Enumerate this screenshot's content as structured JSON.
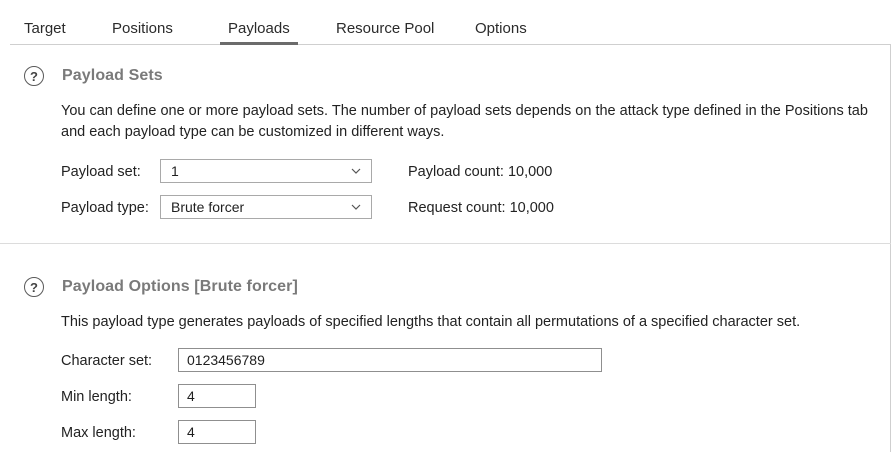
{
  "tabs": [
    {
      "label": "Target"
    },
    {
      "label": "Positions"
    },
    {
      "label": "Payloads"
    },
    {
      "label": "Resource Pool"
    },
    {
      "label": "Options"
    }
  ],
  "active_tab": "Payloads",
  "payload_sets": {
    "title": "Payload Sets",
    "description_line1": "You can define one or more payload sets. The number of payload sets depends on the attack type defined in the Positions tab",
    "description_line2": "and each payload type can be customized in different ways.",
    "payload_set_label": "Payload set:",
    "payload_set_value": "1",
    "payload_type_label": "Payload type:",
    "payload_type_value": "Brute forcer",
    "payload_count": "Payload count: 10,000",
    "request_count": "Request count: 10,000"
  },
  "payload_options": {
    "title": "Payload Options [Brute forcer]",
    "description": "This payload type generates payloads of specified lengths that contain all permutations of a specified character set.",
    "character_set_label": "Character set:",
    "character_set_value": "0123456789",
    "min_length_label": "Min length:",
    "min_length_value": "4",
    "max_length_label": "Max length:",
    "max_length_value": "4"
  },
  "icons": {
    "help": "help-circle-icon",
    "dropdown": "chevron-down-icon"
  },
  "colors": {
    "section_title": "#7a7a7a",
    "active_tab_underline": "#6b6b6b"
  }
}
